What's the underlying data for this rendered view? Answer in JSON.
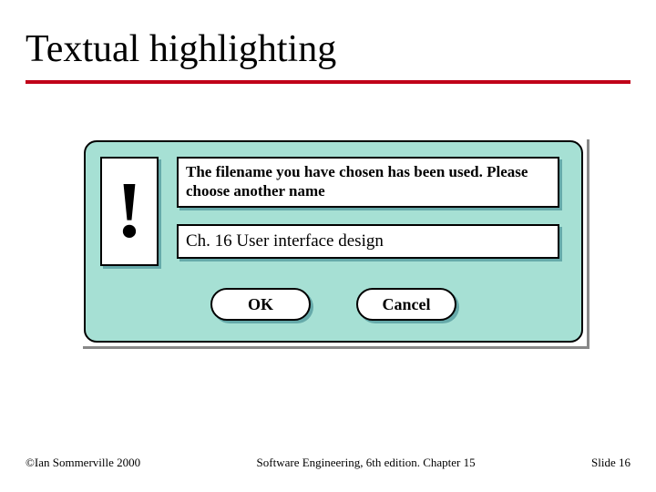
{
  "slide": {
    "title": "Textual highlighting"
  },
  "dialog": {
    "exclaim": "!",
    "message": "The filename you have chosen has been used. Please choose another name",
    "input_value": "Ch. 16 User interface design",
    "ok_label": "OK",
    "cancel_label": "Cancel"
  },
  "footer": {
    "left": "©Ian Sommerville 2000",
    "center": "Software Engineering, 6th edition. Chapter 15",
    "right": "Slide 16"
  }
}
